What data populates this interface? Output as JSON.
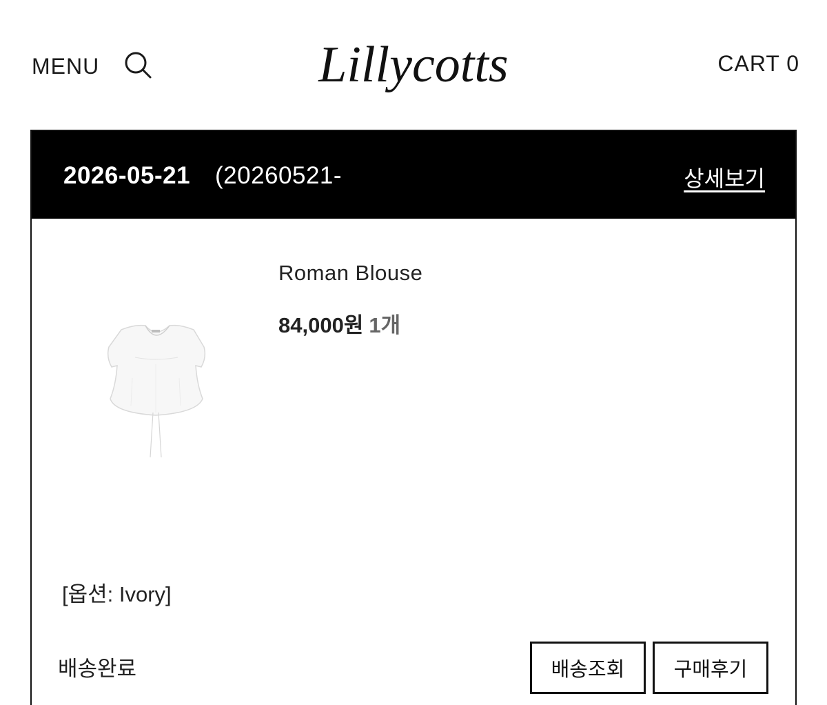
{
  "header": {
    "menu_label": "MENU",
    "search_icon": "search-icon",
    "logo_text": "Lillycotts",
    "cart_label": "CART 0"
  },
  "order": {
    "date": "2026-05-21",
    "order_number": "(20260521-",
    "detail_label": "상세보기",
    "product": {
      "name": "Roman Blouse",
      "price": "84,000원",
      "quantity": "1개",
      "option": "[옵션: Ivory]"
    },
    "status": "배송완료",
    "buttons": {
      "track": "배송조회",
      "review": "구매후기"
    }
  },
  "colors": {
    "header_bg": "#000000",
    "text": "#111111",
    "background": "#ffffff"
  }
}
